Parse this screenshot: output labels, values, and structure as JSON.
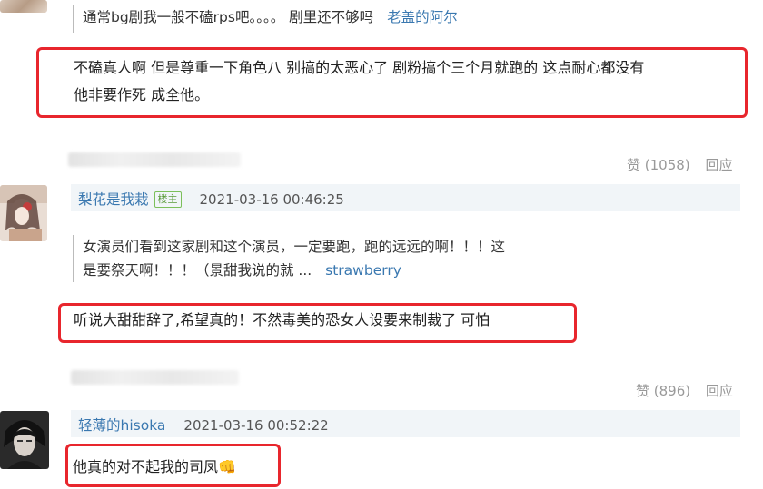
{
  "comments": {
    "c1": {
      "quote_text": "通常bg剧我一般不磕rps吧。。。。 剧里还不够吗",
      "quote_author": "老盖的阿尔",
      "reply_line1": "不磕真人啊 但是尊重一下角色八 别搞的太恶心了 剧粉搞个三个月就跑的 这点耐心都没有",
      "reply_line2": "他非要作死 成全他。",
      "like_label": "赞 (1058)",
      "reply_label": "回应"
    },
    "c2": {
      "username": "梨花是我栽",
      "badge": "楼主",
      "timestamp": "2021-03-16 00:46:25",
      "quote_line1": "女演员们看到这家剧和这个演员，一定要跑，跑的远远的啊！！！这",
      "quote_line2": "是要祭天啊！！！（景甜我说的就 ...",
      "quote_author": "strawberry",
      "reply_text": "听说大甜甜辞了,希望真的！不然毒美的恐女人设要来制裁了 可怕",
      "like_label": "赞 (896)",
      "reply_label": "回应"
    },
    "c3": {
      "username": "轻薄的hisoka",
      "timestamp": "2021-03-16 00:52:22",
      "reply_text": "他真的对不起我的司凤",
      "emoji": "👊"
    }
  },
  "colors": {
    "highlight_box": "#e8262d",
    "link": "#3a78b0",
    "meta": "#999999",
    "user_bar_bg": "#f1f5f8",
    "badge": "#5a9a3a"
  }
}
